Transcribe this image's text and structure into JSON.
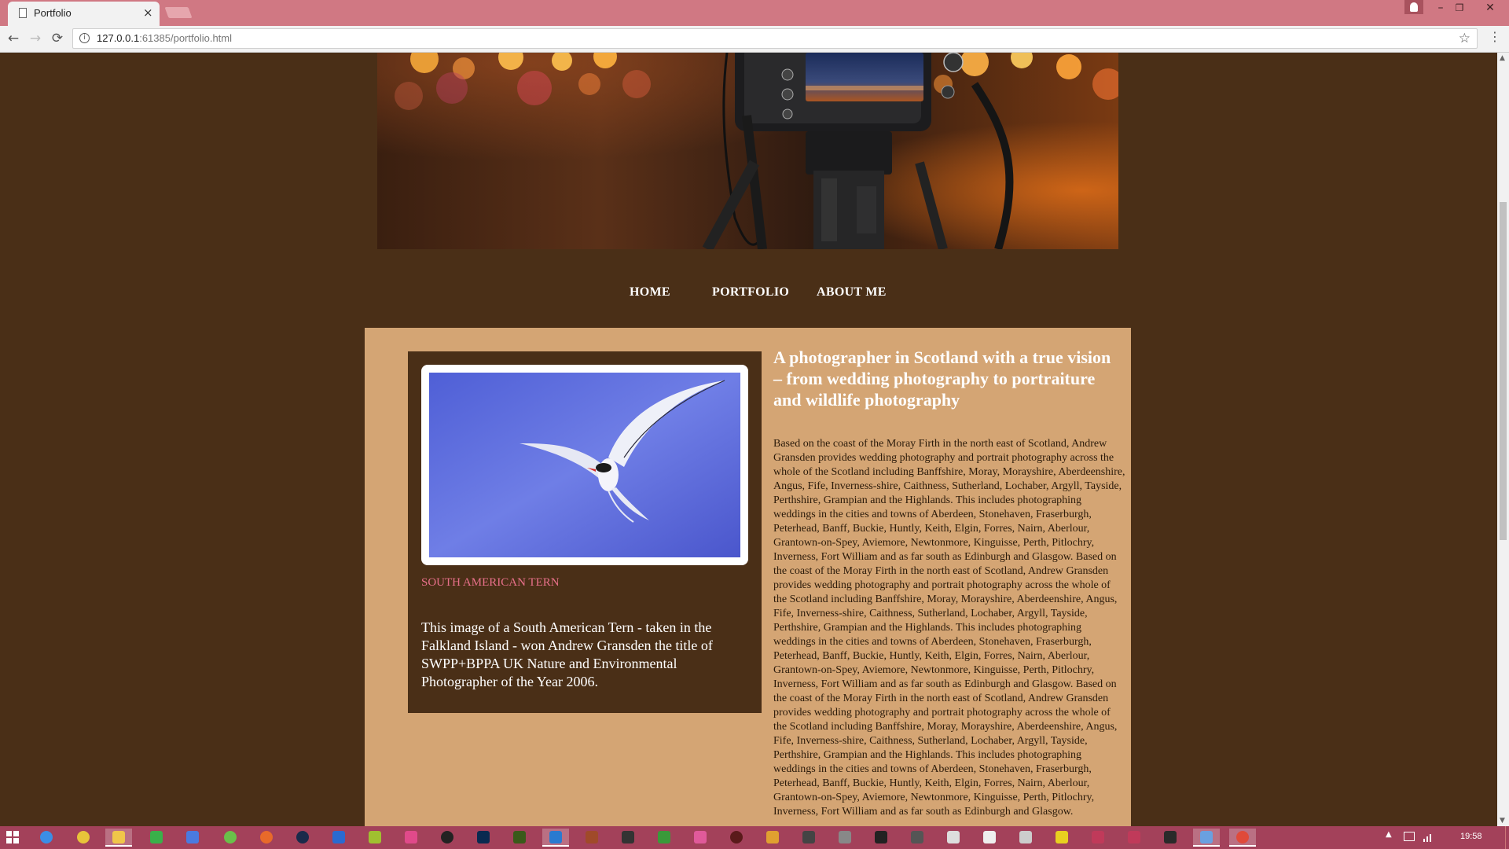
{
  "browser": {
    "tab_title": "Portfolio",
    "tab_close": "×",
    "url_host": "127.0.0.1",
    "url_rest": ":61385/portfolio.html",
    "minimize": "–",
    "restore": "❐",
    "close": "✕",
    "back": "←",
    "forward": "→",
    "reload": "⟳",
    "info": "i",
    "bookmark": "☆",
    "menu": "⋮"
  },
  "nav": {
    "home": "HOME",
    "portfolio": "PORTFOLIO",
    "about": "ABOUT ME"
  },
  "featured": {
    "caption": "SOUTH AMERICAN TERN",
    "description": "This image of a South American Tern - taken in the Falkland Island - won Andrew Gransden the title of SWPP+BPPA UK Nature and Environmental Photographer of the Year 2006."
  },
  "article": {
    "heading": "A photographer in Scotland with a true vision – from wedding photography to portraiture and wildlife photography",
    "body": "Based on the coast of the Moray Firth in the north east of Scotland, Andrew Gransden provides wedding photography and portrait photography across the whole of the Scotland including Banffshire, Moray, Morayshire, Aberdeenshire, Angus, Fife, Inverness-shire, Caithness, Sutherland, Lochaber, Argyll, Tayside, Perthshire, Grampian and the Highlands. This includes photographing weddings in the cities and towns of Aberdeen, Stonehaven, Fraserburgh, Peterhead, Banff, Buckie, Huntly, Keith, Elgin, Forres, Nairn, Aberlour, Grantown-on-Spey, Aviemore, Newtonmore, Kinguisse, Perth, Pitlochry, Inverness, Fort William and as far south as Edinburgh and Glasgow. Based on the coast of the Moray Firth in the north east of Scotland, Andrew Gransden provides wedding photography and portrait photography across the whole of the Scotland including Banffshire, Moray, Morayshire, Aberdeenshire, Angus, Fife, Inverness-shire, Caithness, Sutherland, Lochaber, Argyll, Tayside, Perthshire, Grampian and the Highlands. This includes photographing weddings in the cities and towns of Aberdeen, Stonehaven, Fraserburgh, Peterhead, Banff, Buckie, Huntly, Keith, Elgin, Forres, Nairn, Aberlour, Grantown-on-Spey, Aviemore, Newtonmore, Kinguisse, Perth, Pitlochry, Inverness, Fort William and as far south as Edinburgh and Glasgow. Based on the coast of the Moray Firth in the north east of Scotland, Andrew Gransden provides wedding photography and portrait photography across the whole of the Scotland including Banffshire, Moray, Morayshire, Aberdeenshire, Angus, Fife, Inverness-shire, Caithness, Sutherland, Lochaber, Argyll, Tayside, Perthshire, Grampian and the Highlands. This includes photographing weddings in the cities and towns of Aberdeen, Stonehaven, Fraserburgh, Peterhead, Banff, Buckie, Huntly, Keith, Elgin, Forres, Nairn, Aberlour, Grantown-on-Spey, Aviemore, Newtonmore, Kinguisse, Perth, Pitlochry, Inverness, Fort William and as far south as Edinburgh and Glasgow."
  },
  "colors": {
    "page_background": "#4a2f17",
    "content_background": "#d4a574",
    "caption": "#e8708a",
    "titlebar": "#d07883",
    "taskbar": "#a3415a"
  },
  "taskbar": {
    "clock": "19:58",
    "tray_arrow": "▲"
  }
}
